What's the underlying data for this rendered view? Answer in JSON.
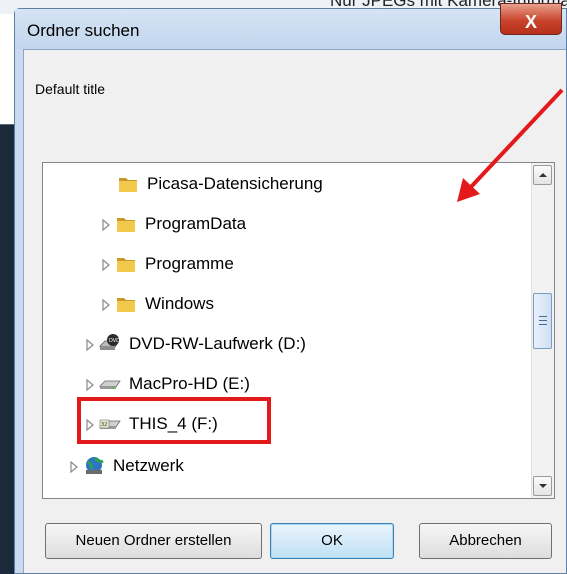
{
  "background": {
    "caption": "Nur JPEGs mit Kamera-Informationen"
  },
  "dialog": {
    "title": "Ordner suchen",
    "close_label": "X",
    "description": "Default title"
  },
  "tree": {
    "items": [
      {
        "label": "Picasa-Datensicherung",
        "icon": "folder-icon",
        "expandable": false
      },
      {
        "label": "ProgramData",
        "icon": "folder-icon",
        "expandable": true
      },
      {
        "label": "Programme",
        "icon": "folder-icon",
        "expandable": true
      },
      {
        "label": "Windows",
        "icon": "folder-icon",
        "expandable": true
      },
      {
        "label": "DVD-RW-Laufwerk (D:)",
        "icon": "dvd-drive-icon",
        "expandable": true
      },
      {
        "label": "MacPro-HD (E:)",
        "icon": "hard-drive-icon",
        "expandable": true
      },
      {
        "label": "THIS_4 (F:)",
        "icon": "usb-drive-icon",
        "expandable": true
      },
      {
        "label": "Netzwerk",
        "icon": "network-icon",
        "expandable": true
      }
    ]
  },
  "buttons": {
    "new_folder": "Neuen Ordner erstellen",
    "ok": "OK",
    "cancel": "Abbrechen"
  },
  "colors": {
    "annotation_red": "#e3191c",
    "folder_yellow": "#e8b73a"
  }
}
